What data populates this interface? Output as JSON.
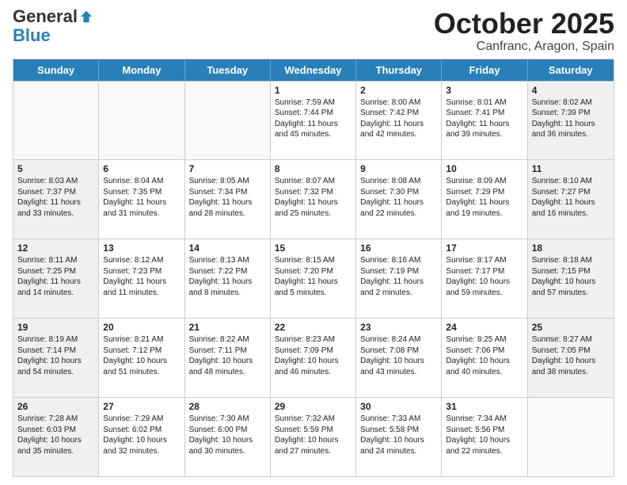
{
  "header": {
    "logo_general": "General",
    "logo_blue": "Blue",
    "month_title": "October 2025",
    "location": "Canfranc, Aragon, Spain"
  },
  "days_of_week": [
    "Sunday",
    "Monday",
    "Tuesday",
    "Wednesday",
    "Thursday",
    "Friday",
    "Saturday"
  ],
  "rows": [
    [
      {
        "day": "",
        "text": "",
        "empty": true
      },
      {
        "day": "",
        "text": "",
        "empty": true
      },
      {
        "day": "",
        "text": "",
        "empty": true
      },
      {
        "day": "1",
        "text": "Sunrise: 7:59 AM\nSunset: 7:44 PM\nDaylight: 11 hours\nand 45 minutes.",
        "empty": false,
        "shaded": false
      },
      {
        "day": "2",
        "text": "Sunrise: 8:00 AM\nSunset: 7:42 PM\nDaylight: 11 hours\nand 42 minutes.",
        "empty": false,
        "shaded": false
      },
      {
        "day": "3",
        "text": "Sunrise: 8:01 AM\nSunset: 7:41 PM\nDaylight: 11 hours\nand 39 minutes.",
        "empty": false,
        "shaded": false
      },
      {
        "day": "4",
        "text": "Sunrise: 8:02 AM\nSunset: 7:39 PM\nDaylight: 11 hours\nand 36 minutes.",
        "empty": false,
        "shaded": true
      }
    ],
    [
      {
        "day": "5",
        "text": "Sunrise: 8:03 AM\nSunset: 7:37 PM\nDaylight: 11 hours\nand 33 minutes.",
        "empty": false,
        "shaded": true
      },
      {
        "day": "6",
        "text": "Sunrise: 8:04 AM\nSunset: 7:35 PM\nDaylight: 11 hours\nand 31 minutes.",
        "empty": false,
        "shaded": false
      },
      {
        "day": "7",
        "text": "Sunrise: 8:05 AM\nSunset: 7:34 PM\nDaylight: 11 hours\nand 28 minutes.",
        "empty": false,
        "shaded": false
      },
      {
        "day": "8",
        "text": "Sunrise: 8:07 AM\nSunset: 7:32 PM\nDaylight: 11 hours\nand 25 minutes.",
        "empty": false,
        "shaded": false
      },
      {
        "day": "9",
        "text": "Sunrise: 8:08 AM\nSunset: 7:30 PM\nDaylight: 11 hours\nand 22 minutes.",
        "empty": false,
        "shaded": false
      },
      {
        "day": "10",
        "text": "Sunrise: 8:09 AM\nSunset: 7:29 PM\nDaylight: 11 hours\nand 19 minutes.",
        "empty": false,
        "shaded": false
      },
      {
        "day": "11",
        "text": "Sunrise: 8:10 AM\nSunset: 7:27 PM\nDaylight: 11 hours\nand 16 minutes.",
        "empty": false,
        "shaded": true
      }
    ],
    [
      {
        "day": "12",
        "text": "Sunrise: 8:11 AM\nSunset: 7:25 PM\nDaylight: 11 hours\nand 14 minutes.",
        "empty": false,
        "shaded": true
      },
      {
        "day": "13",
        "text": "Sunrise: 8:12 AM\nSunset: 7:23 PM\nDaylight: 11 hours\nand 11 minutes.",
        "empty": false,
        "shaded": false
      },
      {
        "day": "14",
        "text": "Sunrise: 8:13 AM\nSunset: 7:22 PM\nDaylight: 11 hours\nand 8 minutes.",
        "empty": false,
        "shaded": false
      },
      {
        "day": "15",
        "text": "Sunrise: 8:15 AM\nSunset: 7:20 PM\nDaylight: 11 hours\nand 5 minutes.",
        "empty": false,
        "shaded": false
      },
      {
        "day": "16",
        "text": "Sunrise: 8:16 AM\nSunset: 7:19 PM\nDaylight: 11 hours\nand 2 minutes.",
        "empty": false,
        "shaded": false
      },
      {
        "day": "17",
        "text": "Sunrise: 8:17 AM\nSunset: 7:17 PM\nDaylight: 10 hours\nand 59 minutes.",
        "empty": false,
        "shaded": false
      },
      {
        "day": "18",
        "text": "Sunrise: 8:18 AM\nSunset: 7:15 PM\nDaylight: 10 hours\nand 57 minutes.",
        "empty": false,
        "shaded": true
      }
    ],
    [
      {
        "day": "19",
        "text": "Sunrise: 8:19 AM\nSunset: 7:14 PM\nDaylight: 10 hours\nand 54 minutes.",
        "empty": false,
        "shaded": true
      },
      {
        "day": "20",
        "text": "Sunrise: 8:21 AM\nSunset: 7:12 PM\nDaylight: 10 hours\nand 51 minutes.",
        "empty": false,
        "shaded": false
      },
      {
        "day": "21",
        "text": "Sunrise: 8:22 AM\nSunset: 7:11 PM\nDaylight: 10 hours\nand 48 minutes.",
        "empty": false,
        "shaded": false
      },
      {
        "day": "22",
        "text": "Sunrise: 8:23 AM\nSunset: 7:09 PM\nDaylight: 10 hours\nand 46 minutes.",
        "empty": false,
        "shaded": false
      },
      {
        "day": "23",
        "text": "Sunrise: 8:24 AM\nSunset: 7:08 PM\nDaylight: 10 hours\nand 43 minutes.",
        "empty": false,
        "shaded": false
      },
      {
        "day": "24",
        "text": "Sunrise: 8:25 AM\nSunset: 7:06 PM\nDaylight: 10 hours\nand 40 minutes.",
        "empty": false,
        "shaded": false
      },
      {
        "day": "25",
        "text": "Sunrise: 8:27 AM\nSunset: 7:05 PM\nDaylight: 10 hours\nand 38 minutes.",
        "empty": false,
        "shaded": true
      }
    ],
    [
      {
        "day": "26",
        "text": "Sunrise: 7:28 AM\nSunset: 6:03 PM\nDaylight: 10 hours\nand 35 minutes.",
        "empty": false,
        "shaded": true
      },
      {
        "day": "27",
        "text": "Sunrise: 7:29 AM\nSunset: 6:02 PM\nDaylight: 10 hours\nand 32 minutes.",
        "empty": false,
        "shaded": false
      },
      {
        "day": "28",
        "text": "Sunrise: 7:30 AM\nSunset: 6:00 PM\nDaylight: 10 hours\nand 30 minutes.",
        "empty": false,
        "shaded": false
      },
      {
        "day": "29",
        "text": "Sunrise: 7:32 AM\nSunset: 5:59 PM\nDaylight: 10 hours\nand 27 minutes.",
        "empty": false,
        "shaded": false
      },
      {
        "day": "30",
        "text": "Sunrise: 7:33 AM\nSunset: 5:58 PM\nDaylight: 10 hours\nand 24 minutes.",
        "empty": false,
        "shaded": false
      },
      {
        "day": "31",
        "text": "Sunrise: 7:34 AM\nSunset: 5:56 PM\nDaylight: 10 hours\nand 22 minutes.",
        "empty": false,
        "shaded": false
      },
      {
        "day": "",
        "text": "",
        "empty": true,
        "shaded": true
      }
    ]
  ]
}
